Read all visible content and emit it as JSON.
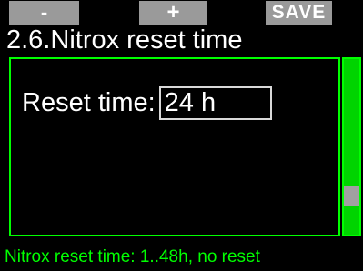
{
  "softkeys": {
    "minus_label": "-",
    "plus_label": "+",
    "save_label": "SAVE"
  },
  "header": {
    "title": "2.6.Nitrox reset time"
  },
  "setting": {
    "label": "Reset time:",
    "value": "24 h"
  },
  "scrollbar": {
    "position_fraction": 0.82
  },
  "status": {
    "text": "Nitrox reset time: 1..48h, no reset"
  },
  "colors": {
    "accent": "#00ff00",
    "softkey_bg": "#9a9a9a",
    "background": "#000000"
  }
}
